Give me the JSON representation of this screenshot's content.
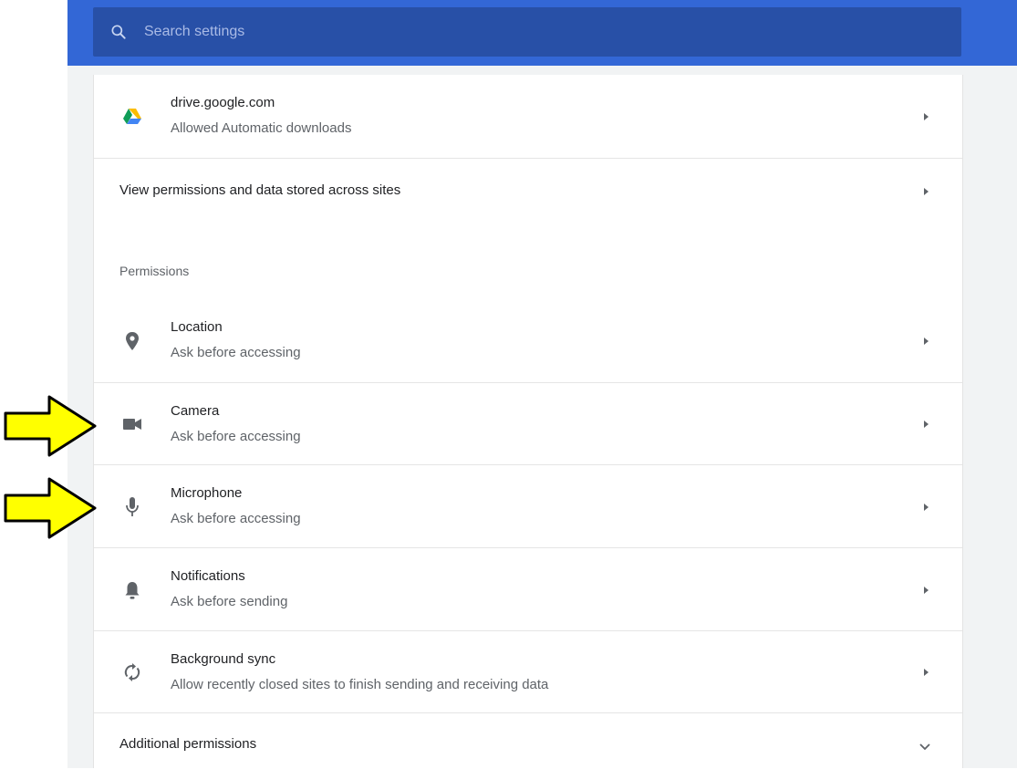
{
  "search": {
    "placeholder": "Search settings",
    "icon": "search-icon"
  },
  "sites": [
    {
      "title": "drive.google.com",
      "subtitle": "Allowed Automatic downloads",
      "icon": "google-drive-icon"
    }
  ],
  "view_all": {
    "label": "View permissions and data stored across sites"
  },
  "permissions": {
    "heading": "Permissions",
    "items": [
      {
        "title": "Location",
        "subtitle": "Ask before accessing",
        "icon": "location-pin-icon"
      },
      {
        "title": "Camera",
        "subtitle": "Ask before accessing",
        "icon": "camera-icon"
      },
      {
        "title": "Microphone",
        "subtitle": "Ask before accessing",
        "icon": "microphone-icon"
      },
      {
        "title": "Notifications",
        "subtitle": "Ask before sending",
        "icon": "bell-icon"
      },
      {
        "title": "Background sync",
        "subtitle": "Allow recently closed sites to finish sending and receiving data",
        "icon": "sync-icon"
      }
    ]
  },
  "additional": {
    "label": "Additional permissions"
  },
  "colors": {
    "header": "#3367d6",
    "search_bg": "#2850a7",
    "annotation_arrow": "#ffff00"
  }
}
